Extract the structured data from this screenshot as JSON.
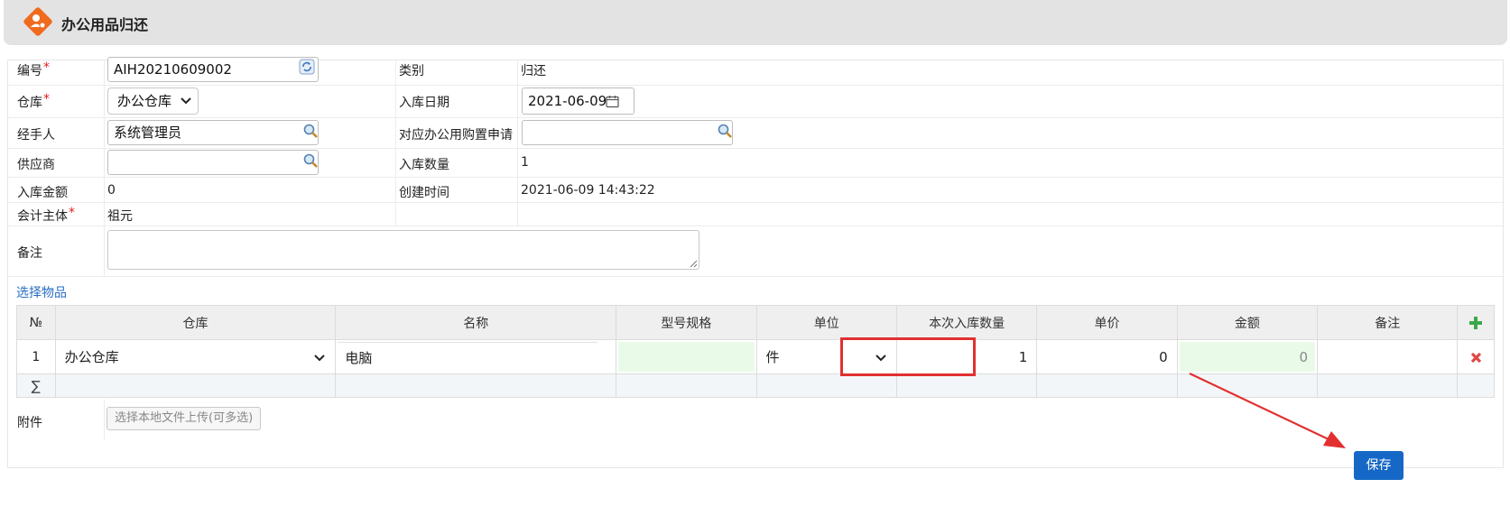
{
  "page_title": "办公用品归还",
  "fields": {
    "code_label": "编号",
    "code_value": "AIH20210609002",
    "category_label": "类别",
    "category_value": "归还",
    "warehouse_label": "仓库",
    "warehouse_value": "办公仓库",
    "in_date_label": "入库日期",
    "in_date_value": "2021-06-09",
    "handler_label": "经手人",
    "handler_value": "系统管理员",
    "purchase_req_label": "对应办公用购置申请",
    "purchase_req_value": "",
    "supplier_label": "供应商",
    "supplier_value": "",
    "in_qty_label": "入库数量",
    "in_qty_value": "1",
    "in_amount_label": "入库金额",
    "in_amount_value": "0",
    "created_label": "创建时间",
    "created_value": "2021-06-09 14:43:22",
    "entity_label": "会计主体",
    "entity_value": "祖元",
    "remark_label": "备注",
    "remark_value": "",
    "required_mark": "*"
  },
  "select_items_link": "选择物品",
  "grid": {
    "headers": [
      "№",
      "仓库",
      "名称",
      "型号规格",
      "单位",
      "本次入库数量",
      "单价",
      "金额",
      "备注"
    ],
    "rows": [
      {
        "no": "1",
        "warehouse": "办公仓库",
        "name": "电脑",
        "spec": "",
        "unit": "件",
        "qty": "1",
        "price": "0",
        "amount": "0",
        "remark": ""
      }
    ],
    "sum_symbol": "∑"
  },
  "attachment_label": "附件",
  "upload_button": "选择本地文件上传(可多选)",
  "save_button": "保存",
  "colors": {
    "header_bg": "#e3e3e3",
    "logo_orange": "#f06a1e",
    "save_blue": "#1668c6",
    "highlight_red": "#e23030",
    "required_red": "#e02020",
    "link_blue": "#2a6fc4"
  }
}
